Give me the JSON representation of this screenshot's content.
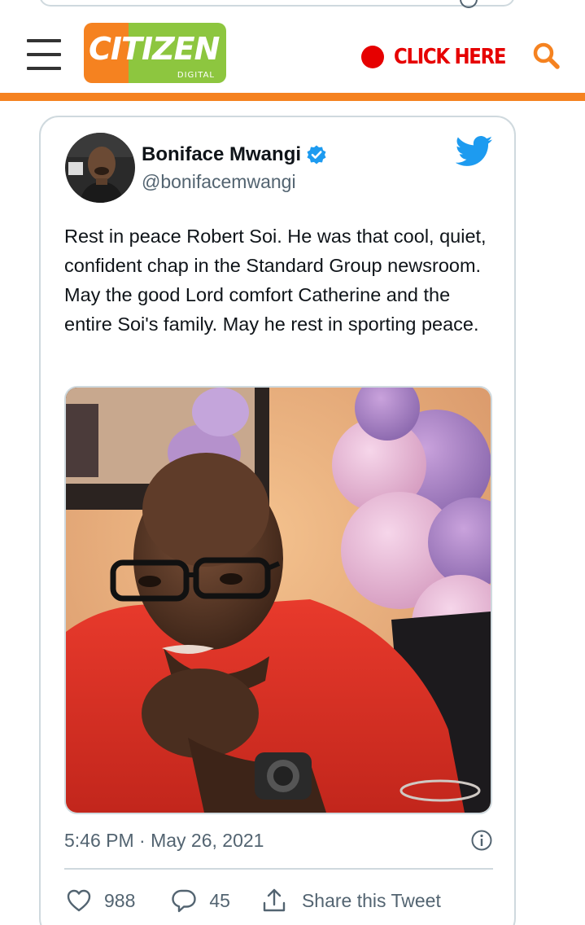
{
  "header": {
    "logo_text": "CITIZEN",
    "logo_subtext": "DIGITAL",
    "click_here_label": "CLICK HERE"
  },
  "colors": {
    "brand_orange": "#f58220",
    "brand_green": "#8dc63f",
    "alert_red": "#e60000",
    "twitter_blue": "#1d9bf0",
    "text_primary": "#0f1419",
    "text_secondary": "#536471",
    "border": "#cfd9de"
  },
  "tweet": {
    "author_name": "Boniface Mwangi",
    "author_handle": "@bonifacemwangi",
    "verified": true,
    "text": "Rest in peace Robert Soi. He was that cool, quiet, confident chap in the Standard Group newsroom. May the good Lord comfort Catherine and the entire Soi's family. May he rest in sporting peace.",
    "timestamp": "5:46 PM · May 26, 2021",
    "likes": "988",
    "replies": "45",
    "share_label": "Share this Tweet"
  },
  "icons": {
    "menu": "hamburger-menu-icon",
    "search": "search-icon",
    "verified": "verified-badge-icon",
    "twitter": "twitter-bird-icon",
    "info": "info-icon",
    "like": "heart-icon",
    "reply": "reply-bubble-icon",
    "share": "share-upload-icon"
  }
}
